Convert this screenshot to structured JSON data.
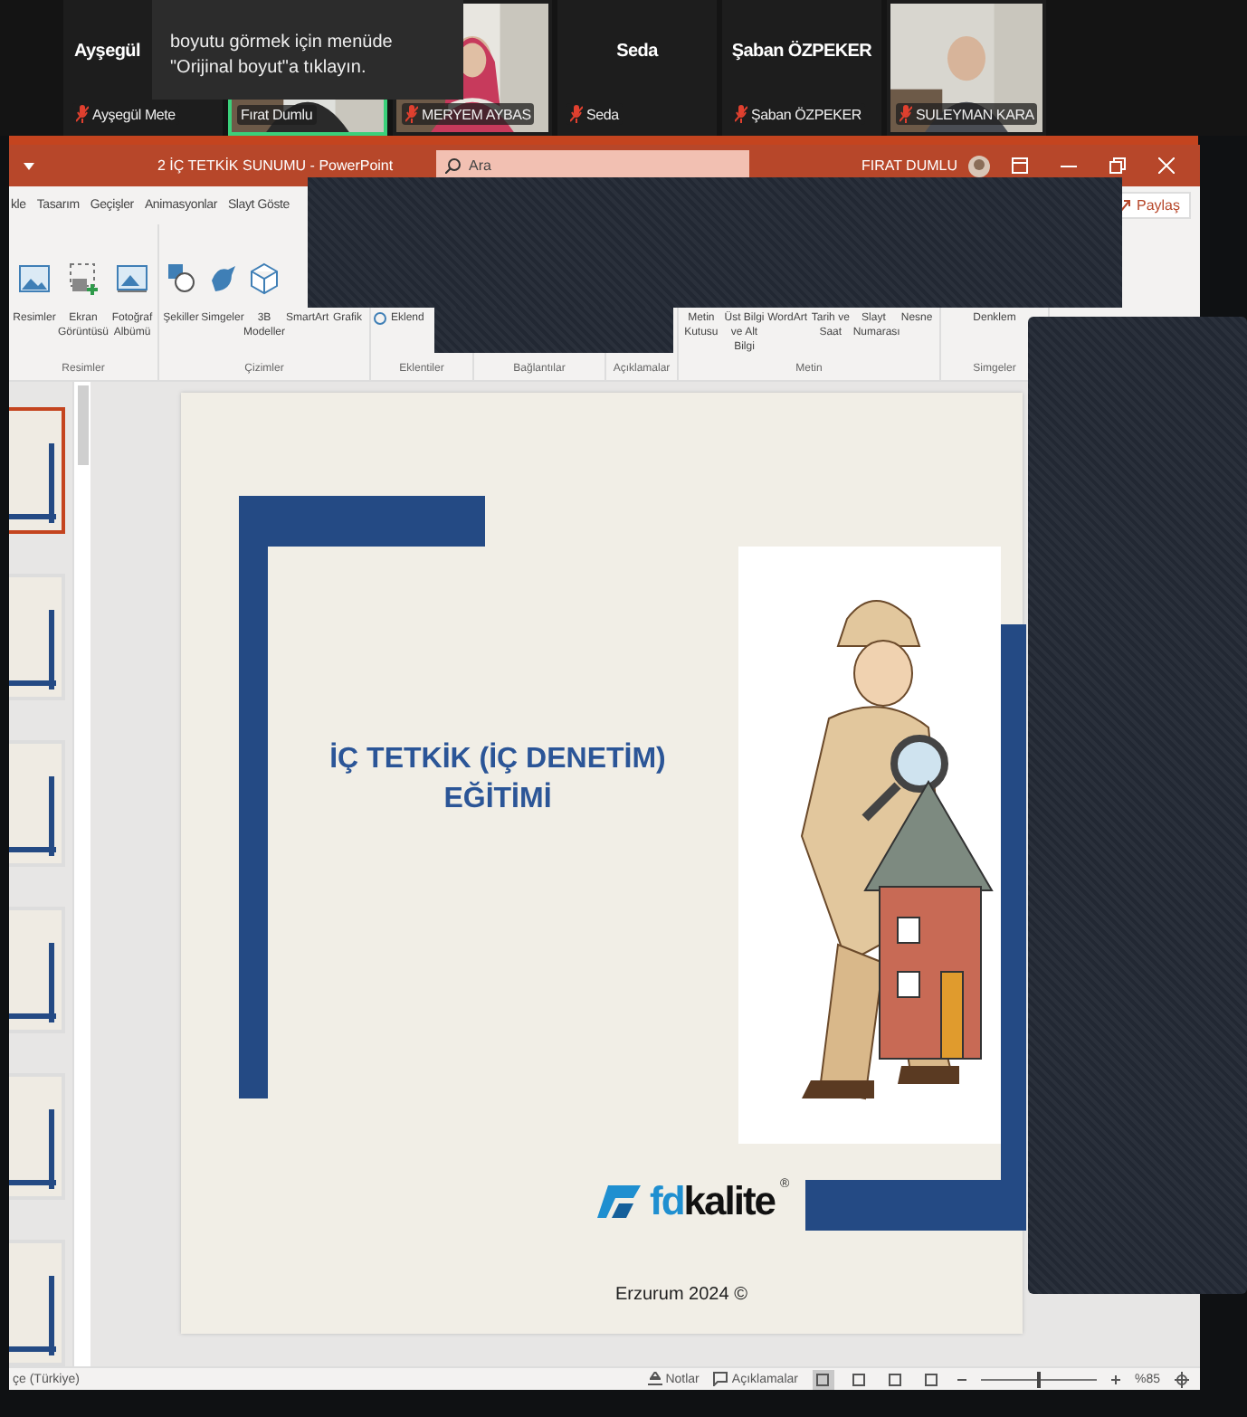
{
  "conference": {
    "tooltip": "boyutu görmek için menüde \"Orijinal boyut\"a tıklayın.",
    "participants": [
      {
        "kind": "name",
        "caption": "Ayşegül",
        "name": "Ayşegül Mete",
        "muted": true,
        "speaking": false
      },
      {
        "kind": "video",
        "name": "Fırat Dumlu",
        "muted": false,
        "speaking": true
      },
      {
        "kind": "video",
        "name": "MERYEM AYBAS",
        "muted": true,
        "speaking": false
      },
      {
        "kind": "name",
        "caption": "Seda",
        "name": "Seda",
        "muted": true,
        "speaking": false
      },
      {
        "kind": "name",
        "caption": "Şaban ÖZPEKER",
        "name": "Şaban ÖZPEKER",
        "muted": true,
        "speaking": false
      },
      {
        "kind": "video",
        "name": "SULEYMAN KARA",
        "muted": true,
        "speaking": false
      }
    ]
  },
  "window": {
    "title": "2 İÇ TETKİK SUNUMU  -  PowerPoint",
    "search": {
      "placeholder": "Ara"
    },
    "user": "FIRAT DUMLU"
  },
  "ribbon_tabs": [
    "kle",
    "Tasarım",
    "Geçişler",
    "Animasyonlar",
    "Slayt Göste"
  ],
  "share_button": "Paylaş",
  "ribbon_groups": [
    {
      "label": "Resimler",
      "items": [
        {
          "kind": "picture",
          "label": "Resimler"
        },
        {
          "kind": "screenshot",
          "label": "Ekran Görüntüsü"
        },
        {
          "kind": "album",
          "label": "Fotoğraf Albümü"
        }
      ]
    },
    {
      "label": "Çizimler",
      "items": [
        {
          "kind": "shapes",
          "label": "Şekiller"
        },
        {
          "kind": "icons",
          "label": "Simgeler"
        },
        {
          "kind": "cube",
          "label": "3B Modeller"
        },
        {
          "kind": "text",
          "label": "SmartArt"
        },
        {
          "kind": "text",
          "label": "Grafik"
        }
      ]
    },
    {
      "label": "Eklentiler",
      "items": [
        {
          "kind": "addin",
          "label": "Eklend"
        }
      ]
    },
    {
      "label": "Bağlantılar"
    },
    {
      "label": "Açıklamalar"
    },
    {
      "label": "Metin",
      "items": [
        {
          "kind": "text",
          "label": "Metin Kutusu"
        },
        {
          "kind": "text",
          "label": "Üst Bilgi ve Alt Bilgi"
        },
        {
          "kind": "text",
          "label": "WordArt"
        },
        {
          "kind": "text",
          "label": "Tarih ve Saat"
        },
        {
          "kind": "text",
          "label": "Slayt Numarası"
        },
        {
          "kind": "text",
          "label": "Nesne"
        }
      ]
    },
    {
      "label": "Simgeler",
      "items": [
        {
          "kind": "text",
          "label": "Denklem"
        }
      ]
    }
  ],
  "thumbnails": [
    {
      "selected": true
    },
    {
      "selected": false
    },
    {
      "selected": false
    },
    {
      "selected": false
    },
    {
      "selected": false
    },
    {
      "selected": false
    }
  ],
  "slide": {
    "title": "İÇ TETKİK (İÇ DENETİM) EĞİTİMİ",
    "logo": {
      "prefix": "fd",
      "suffix": "kalite",
      "mark": "®"
    },
    "footer": "Erzurum 2024 ©"
  },
  "status_bar": {
    "language": "çe (Türkiye)",
    "notes": "Notlar",
    "comments": "Açıklamalar",
    "views": [
      {
        "selected": true
      },
      {
        "selected": false
      },
      {
        "selected": false
      },
      {
        "selected": false
      }
    ],
    "zoom": {
      "level": 0.5,
      "reading": "%85"
    }
  }
}
